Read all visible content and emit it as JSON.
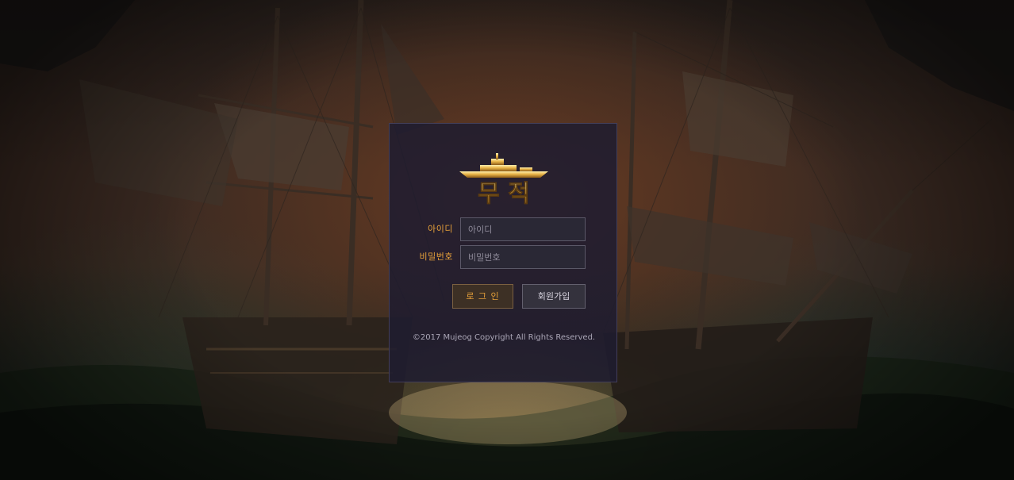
{
  "logo": {
    "text": "무 적",
    "icon": "ship-icon"
  },
  "login": {
    "id_label": "아이디",
    "id_placeholder": "아이디",
    "id_value": "",
    "password_label": "비밀번호",
    "password_placeholder": "비밀번호",
    "password_value": "",
    "login_button": "로 그 인",
    "signup_button": "회원가입"
  },
  "footer": {
    "copyright": "©2017 Mujeog Copyright All Rights Reserved."
  },
  "colors": {
    "accent": "#e6a03a",
    "panel": "#1e1c30",
    "input_border": "#5b5868"
  }
}
